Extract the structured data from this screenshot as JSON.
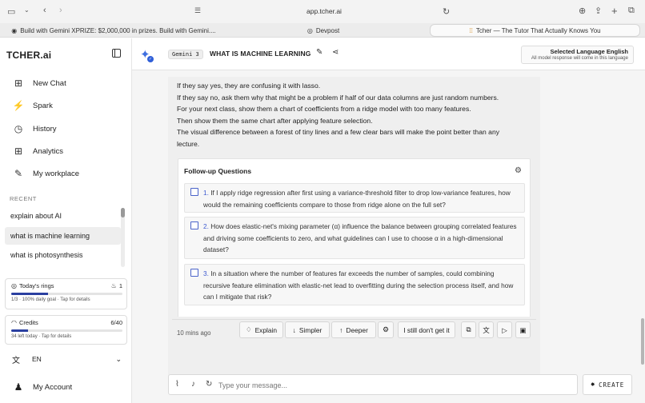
{
  "browser": {
    "url": "app.tcher.ai",
    "tabs": [
      {
        "label": "Build with Gemini XPRIZE: $2,000,000 in prizes. Build with Gemini....",
        "active": false
      },
      {
        "label": "Devpost",
        "active": false
      },
      {
        "label": "Tcher — The Tutor That Actually Knows You",
        "active": true
      }
    ]
  },
  "sidebar": {
    "brand": "TCH⁠ER.ai",
    "nav": [
      {
        "label": "New Chat",
        "icon": "new-chat-icon"
      },
      {
        "label": "Spark",
        "icon": "bolt-icon"
      },
      {
        "label": "History",
        "icon": "clock-icon"
      },
      {
        "label": "Analytics",
        "icon": "grid-icon"
      },
      {
        "label": "My workplace",
        "icon": "edit-icon"
      }
    ],
    "recent_heading": "RECENT",
    "recent": [
      "explain about AI",
      "what is machine learning",
      "what is photosynthesis"
    ],
    "rings": {
      "label": "Today's rings",
      "count": "1",
      "sub": "1/3 · 100% daily goal · Tap for details",
      "progress": 0.33
    },
    "credits": {
      "label": "Credits",
      "value": "6/40",
      "sub": "34 left today · Tap for details",
      "progress": 0.15
    },
    "language": "EN",
    "account": "My Account"
  },
  "header": {
    "model": "Gemini 3",
    "title": "WHAT IS MACHINE LEARNING",
    "lang_title": "Selected Language English",
    "lang_sub": "All model response will come in this language"
  },
  "message": {
    "lines": [
      "If they say yes, they are confusing it with lasso.",
      "If they say no, ask them why that might be a problem if half of our data columns are just random numbers.",
      "For your next class, show them a chart of coefficients from a ridge model with too many features.",
      "Then show them the same chart after applying feature selection.",
      "The visual difference between a forest of tiny lines and a few clear bars will make the point better than any",
      "lecture."
    ]
  },
  "followup": {
    "title": "Follow-up Questions",
    "questions": [
      {
        "num": "1.",
        "text": "If I apply ridge regression after first using a variance-threshold filter to drop low-variance features, how would the remaining coefficients compare to those from ridge alone on the full set?"
      },
      {
        "num": "2.",
        "text": "How does elastic-net's mixing parameter (α) influence the balance between grouping correlated features and driving some coefficients to zero, and what guidelines can I use to choose α in a high-dimensional dataset?"
      },
      {
        "num": "3.",
        "text": "In a situation where the number of features far exceeds the number of samples, could combining recursive feature elimination with elastic-net lead to overfitting during the selection process itself, and how can I mitigate that risk?"
      }
    ]
  },
  "actions": {
    "time": "10 mins ago",
    "explain": "Explain",
    "simpler": "Simpler",
    "deeper": "Deeper",
    "dont_get": "I still don't get it"
  },
  "composer": {
    "placeholder": "Type your message...",
    "value": "",
    "create": "CREATE"
  }
}
